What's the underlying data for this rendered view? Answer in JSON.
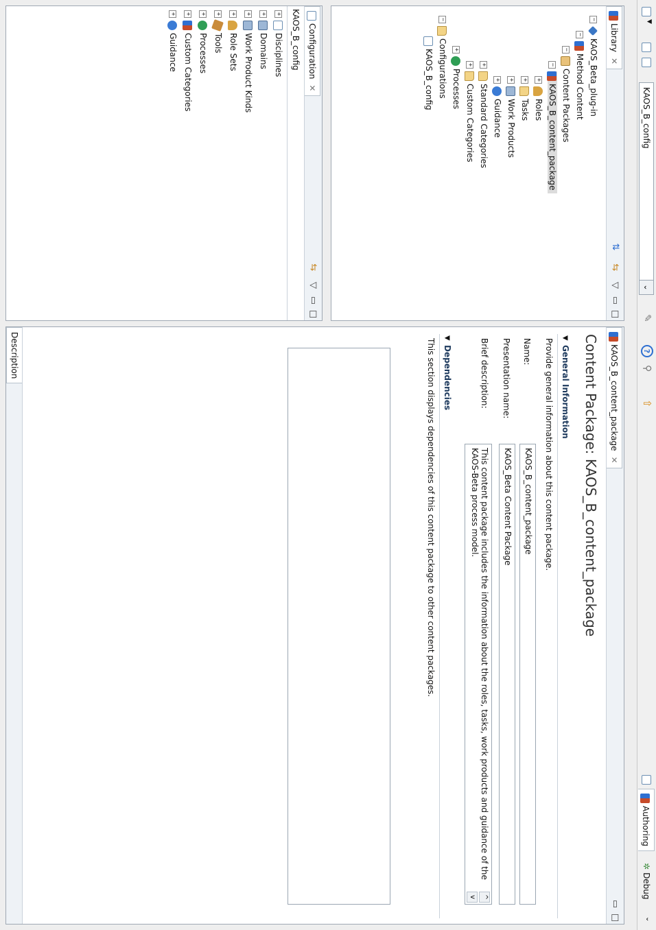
{
  "toolbar": {
    "config_select": "KAOS_B_config",
    "perspectives": [
      {
        "label": "Authoring",
        "icon": "authoring-perspective-icon"
      },
      {
        "label": "Debug",
        "icon": "debug-perspective-icon"
      }
    ]
  },
  "library_view": {
    "tab_label": "Library",
    "tree": [
      {
        "label": "KAOS_Beta_plug-in",
        "icon": "plugin-icon"
      },
      {
        "label": "Method Content",
        "icon": "method-content-icon"
      },
      {
        "label": "Content Packages",
        "icon": "content-packages-icon"
      },
      {
        "label": "KAOS_B_content_package",
        "icon": "content-package-icon"
      },
      {
        "label": "Roles",
        "icon": "roles-folder-icon"
      },
      {
        "label": "Tasks",
        "icon": "tasks-folder-icon"
      },
      {
        "label": "Work Products",
        "icon": "work-products-icon"
      },
      {
        "label": "Guidance",
        "icon": "guidance-icon"
      },
      {
        "label": "Standard Categories",
        "icon": "standard-categories-icon"
      },
      {
        "label": "Custom Categories",
        "icon": "custom-categories-icon"
      },
      {
        "label": "Processes",
        "icon": "processes-icon"
      },
      {
        "label": "Configurations",
        "icon": "configurations-icon"
      },
      {
        "label": "KAOS_B_config",
        "icon": "config-icon"
      }
    ]
  },
  "configuration_view": {
    "tab_label": "Configuration",
    "root": "KAOS_B_config",
    "tree": [
      {
        "label": "Disciplines",
        "icon": "disciplines-icon"
      },
      {
        "label": "Domains",
        "icon": "domains-icon"
      },
      {
        "label": "Work Product Kinds",
        "icon": "work-product-kinds-icon"
      },
      {
        "label": "Role Sets",
        "icon": "role-sets-icon"
      },
      {
        "label": "Tools",
        "icon": "tools-icon"
      },
      {
        "label": "Processes",
        "icon": "processes-icon"
      },
      {
        "label": "Custom Categories",
        "icon": "custom-categories-icon"
      },
      {
        "label": "Guidance",
        "icon": "guidance-icon"
      }
    ]
  },
  "editor": {
    "tab_label": "KAOS_B_content_package",
    "title": "Content Package: KAOS_B_content_package",
    "general": {
      "heading": "General Information",
      "intro": "Provide general information about this content package.",
      "name_label": "Name:",
      "name_value": "KAOS_B_content_package",
      "presentation_label": "Presentation name:",
      "presentation_value": "KAOS_Beta Content Package",
      "brief_label": "Brief description:",
      "brief_line1": "This content package includes the information about the roles, tasks, work products and guidance of the",
      "brief_line2": "KAOS-Beta process model."
    },
    "dependencies": {
      "heading": "Dependencies",
      "text": "This section displays dependencies of this content package to other content packages."
    },
    "bottom_tab": "Description"
  }
}
